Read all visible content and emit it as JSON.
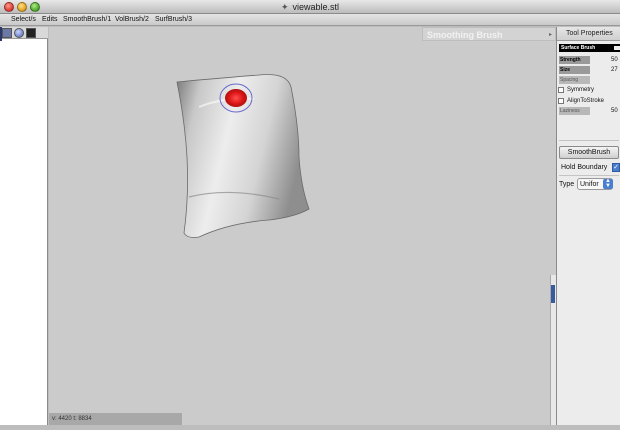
{
  "window": {
    "title": "viewable.stl",
    "file_icon": "document-icon"
  },
  "menu": [
    {
      "label": "Select/s"
    },
    {
      "label": "Edits"
    },
    {
      "label": "SmoothBrush/1"
    },
    {
      "label": "VolBrush/2"
    },
    {
      "label": "SurfBrush/3"
    }
  ],
  "status_bar": {
    "text": "v: 4420  t: 8834"
  },
  "brush_panel": {
    "title": "Smoothing Brush",
    "arrow": "▸"
  },
  "tool_properties": {
    "header": "Tool Properties",
    "section_title": "Surface Brush",
    "strength": {
      "label": "Strength",
      "value": "50"
    },
    "size": {
      "label": "Size",
      "value": "27"
    },
    "spacing": {
      "label": "Spacing",
      "value": ""
    },
    "symmetry": {
      "label": "Symmetry",
      "checked": false
    },
    "align_to_stroke": {
      "label": "AlignToStroke",
      "checked": false
    },
    "laziness": {
      "label": "Laziness",
      "value": "50"
    },
    "smooth_brush_button": "SmoothBrush",
    "hold_boundary": {
      "label": "Hold Boundary",
      "checked": true
    },
    "type": {
      "label": "Type",
      "value": "Unifor"
    }
  },
  "colors": {
    "viewport": "#cbcbcb",
    "brush_spot": "#e01818",
    "accent": "#4a7fd0"
  }
}
